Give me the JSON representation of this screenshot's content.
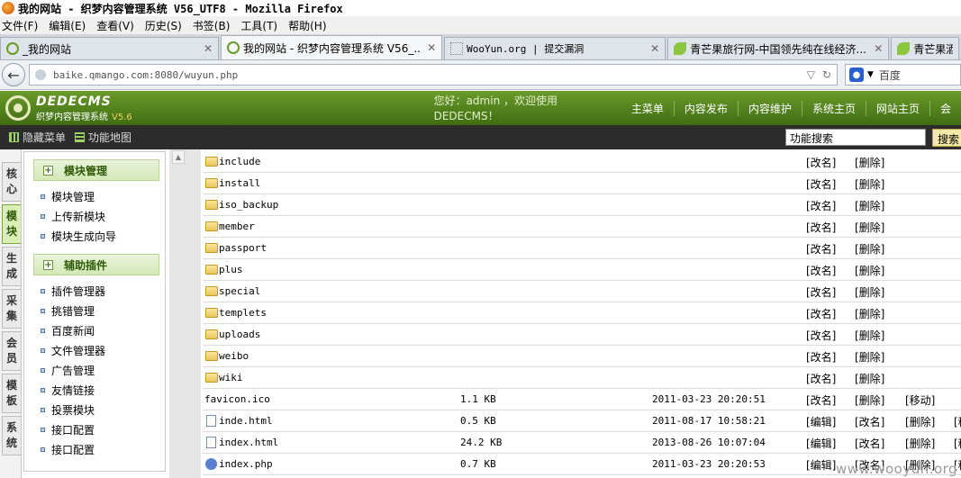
{
  "window": {
    "title": "我的网站 - 织梦内容管理系统 V56_UTF8 - Mozilla Firefox"
  },
  "menubar": [
    "文件(F)",
    "编辑(E)",
    "查看(V)",
    "历史(S)",
    "书签(B)",
    "工具(T)",
    "帮助(H)"
  ],
  "tabs": [
    {
      "label": "_我的网站",
      "active": false
    },
    {
      "label": "我的网站 - 织梦内容管理系统 V56_...",
      "active": true
    },
    {
      "label": "WooYun.org | 提交漏洞",
      "active": false
    },
    {
      "label": "青芒果旅行网-中国领先纯在线经济...",
      "active": false
    },
    {
      "label": "青芒果酒...",
      "active": false
    }
  ],
  "navbar": {
    "url": "baike.qmango.com:8080/wuyun.php",
    "search_engine": "百度"
  },
  "header": {
    "brand": "DEDECMS",
    "subtitle": "织梦内容管理系统",
    "version": "V5.6",
    "welcome": "您好：admin ，欢迎使用DEDECMS！",
    "nav": [
      "主菜单",
      "内容发布",
      "内容维护",
      "系统主页",
      "网站主页",
      "会"
    ]
  },
  "toolbar": {
    "hide_menu": "隐藏菜单",
    "func_map": "功能地图",
    "search_value": "功能搜索",
    "search_button": "搜索"
  },
  "vtabs": [
    {
      "label": [
        "核",
        "心"
      ],
      "active": false
    },
    {
      "label": [
        "模",
        "块"
      ],
      "active": true
    },
    {
      "label": [
        "生",
        "成"
      ],
      "active": false
    },
    {
      "label": [
        "采",
        "集"
      ],
      "active": false
    },
    {
      "label": [
        "会",
        "员"
      ],
      "active": false
    },
    {
      "label": [
        "模",
        "板"
      ],
      "active": false
    },
    {
      "label": [
        "系",
        "统"
      ],
      "active": false
    }
  ],
  "sidebar": {
    "groups": [
      {
        "title": "模块管理",
        "items": [
          "模块管理",
          "上传新模块",
          "模块生成向导"
        ]
      },
      {
        "title": "辅助插件",
        "items": [
          "插件管理器",
          "挑错管理",
          "百度新闻",
          "文件管理器",
          "广告管理",
          "友情链接",
          "投票模块",
          "接口配置",
          "接口配置"
        ]
      }
    ]
  },
  "files": [
    {
      "name": "include",
      "type": "folder",
      "size": "",
      "date": "",
      "actions": [
        "[改名]",
        "[删除]"
      ]
    },
    {
      "name": "install",
      "type": "folder",
      "size": "",
      "date": "",
      "actions": [
        "[改名]",
        "[删除]"
      ]
    },
    {
      "name": "iso_backup",
      "type": "folder",
      "size": "",
      "date": "",
      "actions": [
        "[改名]",
        "[删除]"
      ]
    },
    {
      "name": "member",
      "type": "folder",
      "size": "",
      "date": "",
      "actions": [
        "[改名]",
        "[删除]"
      ]
    },
    {
      "name": "passport",
      "type": "folder",
      "size": "",
      "date": "",
      "actions": [
        "[改名]",
        "[删除]"
      ]
    },
    {
      "name": "plus",
      "type": "folder",
      "size": "",
      "date": "",
      "actions": [
        "[改名]",
        "[删除]"
      ]
    },
    {
      "name": "special",
      "type": "folder",
      "size": "",
      "date": "",
      "actions": [
        "[改名]",
        "[删除]"
      ]
    },
    {
      "name": "templets",
      "type": "folder",
      "size": "",
      "date": "",
      "actions": [
        "[改名]",
        "[删除]"
      ]
    },
    {
      "name": "uploads",
      "type": "folder",
      "size": "",
      "date": "",
      "actions": [
        "[改名]",
        "[删除]"
      ]
    },
    {
      "name": "weibo",
      "type": "folder",
      "size": "",
      "date": "",
      "actions": [
        "[改名]",
        "[删除]"
      ]
    },
    {
      "name": "wiki",
      "type": "folder",
      "size": "",
      "date": "",
      "actions": [
        "[改名]",
        "[删除]"
      ]
    },
    {
      "name": "favicon.ico",
      "type": "plain",
      "size": "1.1 KB",
      "date": "2011-03-23 20:20:51",
      "actions": [
        "[改名]",
        "[删除]",
        "[移动]"
      ]
    },
    {
      "name": "inde.html",
      "type": "html",
      "size": "0.5 KB",
      "date": "2011-08-17 10:58:21",
      "actions": [
        "[编辑]",
        "[改名]",
        "[删除]",
        "[移"
      ]
    },
    {
      "name": "index.html",
      "type": "html",
      "size": "24.2 KB",
      "date": "2013-08-26 10:07:04",
      "actions": [
        "[编辑]",
        "[改名]",
        "[删除]",
        "[移"
      ]
    },
    {
      "name": "index.php",
      "type": "php",
      "size": "0.7 KB",
      "date": "2011-03-23 20:20:53",
      "actions": [
        "[编辑]",
        "[改名]",
        "[删除]",
        "[移"
      ]
    }
  ],
  "watermark": "www.wooyun.org"
}
